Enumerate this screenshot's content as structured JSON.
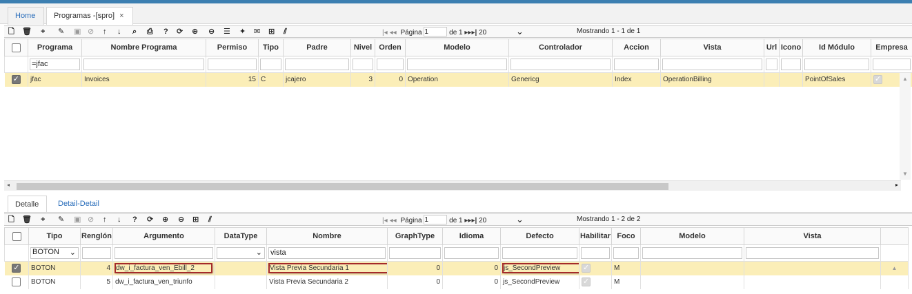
{
  "tabs": {
    "home": "Home",
    "active": "Programas -[spro]",
    "close": "×"
  },
  "toolbar_top": {
    "icons": [
      "new-file-icon",
      "delete-icon",
      "add-icon",
      "edit-icon",
      "save-icon",
      "cancel-icon",
      "up-arrow-icon",
      "down-arrow-icon",
      "search-icon",
      "print-icon",
      "help-icon",
      "refresh-icon",
      "zoom-in-icon",
      "zoom-out-icon",
      "comment-icon",
      "pin-icon",
      "mail-icon",
      "plus-circle-icon",
      "columns-icon"
    ],
    "pager": {
      "label_page": "Página",
      "page_value": "1",
      "label_of": "de 1",
      "page_size": "20",
      "status": "Mostrando 1 - 1 de 1"
    }
  },
  "master": {
    "columns": [
      "Programa",
      "Nombre Programa",
      "Permiso",
      "Tipo",
      "Padre",
      "Nivel",
      "Orden",
      "Modelo",
      "Controlador",
      "Accion",
      "Vista",
      "Url",
      "Icono",
      "Id Módulo",
      "Empresa"
    ],
    "filter": {
      "programa": "=jfac"
    },
    "rows": [
      {
        "programa": "jfac",
        "nombre": "Invoices",
        "permiso": "15",
        "tipo": "C",
        "padre": "jcajero",
        "nivel": "3",
        "orden": "0",
        "modelo": "Operation",
        "controlador": "Genericg",
        "accion": "Index",
        "vista": "OperationBilling",
        "url": "",
        "icono": "",
        "id_modulo": "PointOfSales",
        "empresa_checked": true
      }
    ]
  },
  "subtabs": {
    "detalle": "Detalle",
    "detail_detail": "Detail-Detail"
  },
  "toolbar_bottom": {
    "pager": {
      "label_page": "Página",
      "page_value": "1",
      "label_of": "de 1",
      "page_size": "20",
      "status": "Mostrando 1 - 2 de 2"
    }
  },
  "detail": {
    "columns": [
      "Tipo",
      "Renglón",
      "Argumento",
      "DataType",
      "Nombre",
      "GraphType",
      "Idioma",
      "Defecto",
      "Habilitar",
      "Foco",
      "Modelo",
      "Vista"
    ],
    "filter": {
      "tipo": "BOTON",
      "nombre": "vista"
    },
    "rows": [
      {
        "selected": true,
        "tipo": "BOTON",
        "renglon": "4",
        "argumento": "dw_i_factura_ven_Ebill_2",
        "datatype": "",
        "nombre": "Vista Previa Secundaria 1",
        "graphtype": "0",
        "idioma": "0",
        "defecto": "js_SecondPreview",
        "foco": "M",
        "modelo": "",
        "vista": ""
      },
      {
        "selected": false,
        "tipo": "BOTON",
        "renglon": "5",
        "argumento": "dw_i_factura_ven_triunfo",
        "datatype": "",
        "nombre": "Vista Previa Secundaria 2",
        "graphtype": "0",
        "idioma": "0",
        "defecto": "js_SecondPreview",
        "foco": "M",
        "modelo": "",
        "vista": ""
      }
    ]
  },
  "colors": {
    "accent": "#3c7fb1",
    "selected_row": "#fbeeb8",
    "highlight_box": "#a52a2a",
    "link": "#2a6ebb"
  }
}
